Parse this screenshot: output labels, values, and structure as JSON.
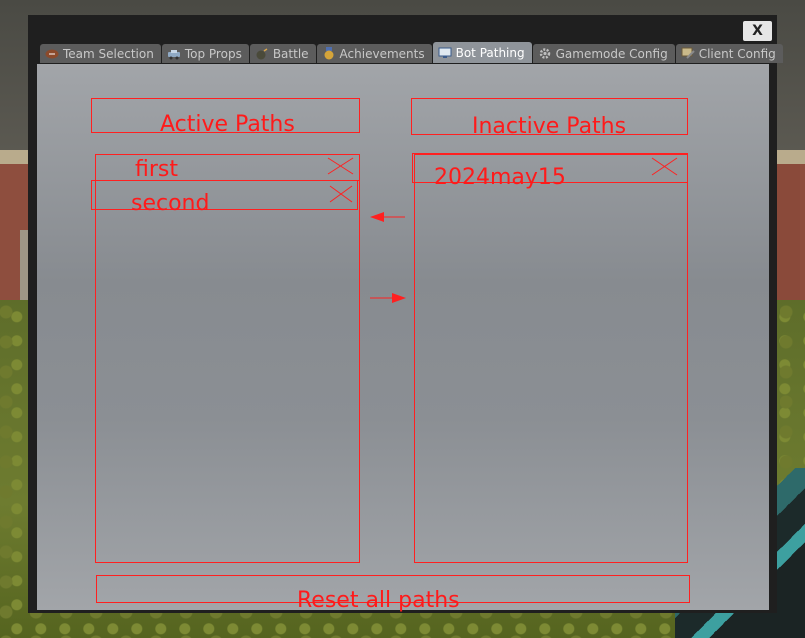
{
  "window": {
    "close_label": "X"
  },
  "tabs": [
    {
      "label": "Team Selection",
      "icon": "football-icon",
      "active": false
    },
    {
      "label": "Top Props",
      "icon": "car-icon",
      "active": false
    },
    {
      "label": "Battle",
      "icon": "bomb-icon",
      "active": false
    },
    {
      "label": "Achievements",
      "icon": "medal-icon",
      "active": false
    },
    {
      "label": "Bot Pathing",
      "icon": "monitor-icon",
      "active": true
    },
    {
      "label": "Gamemode Config",
      "icon": "gear-icon",
      "active": false
    },
    {
      "label": "Client Config",
      "icon": "wrench-icon",
      "active": false
    }
  ],
  "active_paths": {
    "title": "Active Paths",
    "items": [
      "first",
      "second"
    ]
  },
  "inactive_paths": {
    "title": "Inactive Paths",
    "items": [
      "2024may15"
    ]
  },
  "controls": {
    "move_left_icon": "arrow-left-icon",
    "move_right_icon": "arrow-right-icon",
    "reset_label": "Reset all paths"
  },
  "colors": {
    "accent": "#ff1a1a",
    "panel": "#8f949a",
    "tab_active": "#8f949a"
  }
}
